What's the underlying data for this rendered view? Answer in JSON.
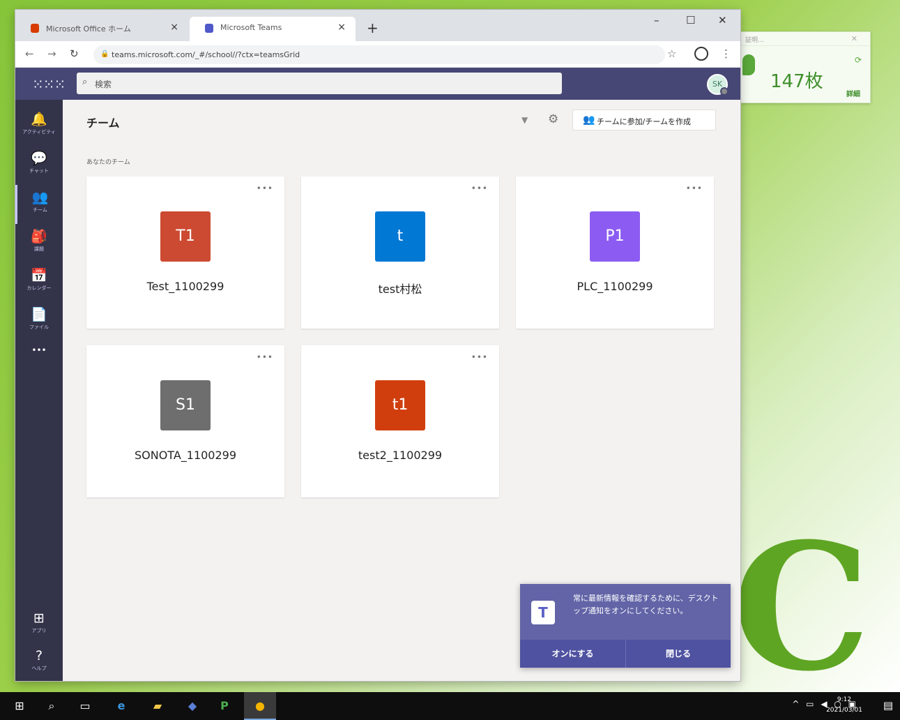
{
  "desktop": {
    "widget": {
      "title": "証明…",
      "count": "147枚",
      "link": "詳細"
    },
    "big_letter": "C"
  },
  "browser": {
    "tabs": [
      {
        "label": "Microsoft Office ホーム",
        "icon": "office-icon",
        "color": "#d83b01"
      },
      {
        "label": "Microsoft Teams",
        "icon": "teams-icon",
        "color": "#5059c9"
      }
    ],
    "url": "teams.microsoft.com/_#/school//?ctx=teamsGrid"
  },
  "teams": {
    "search_placeholder": "検索",
    "avatar_initials": "SK",
    "rail": [
      {
        "label": "アクティビティ",
        "icon": "bell-icon",
        "glyph": "🔔"
      },
      {
        "label": "チャット",
        "icon": "chat-icon",
        "glyph": "💬"
      },
      {
        "label": "チーム",
        "icon": "teams-icon",
        "glyph": "👥"
      },
      {
        "label": "課題",
        "icon": "assignments-icon",
        "glyph": "🎒"
      },
      {
        "label": "カレンダー",
        "icon": "calendar-icon",
        "glyph": "📅"
      },
      {
        "label": "ファイル",
        "icon": "file-icon",
        "glyph": "📄"
      },
      {
        "label": "",
        "icon": "more-icon",
        "glyph": "•••"
      }
    ],
    "rail_bottom": [
      {
        "label": "アプリ",
        "icon": "apps-icon",
        "glyph": "⊞"
      },
      {
        "label": "ヘルプ",
        "icon": "help-icon",
        "glyph": "?"
      }
    ],
    "page_title": "チーム",
    "join_button": "チームに参加/チームを作成",
    "section_label": "あなたのチーム",
    "cards": [
      {
        "initials": "T1",
        "name": "Test_1100299",
        "color": "#cc4a31"
      },
      {
        "initials": "t",
        "name": "test村松",
        "color": "#0078d4"
      },
      {
        "initials": "P1",
        "name": "PLC_1100299",
        "color": "#8c5cf2"
      },
      {
        "initials": "S1",
        "name": "SONOTA_1100299",
        "color": "#6e6e6e"
      },
      {
        "initials": "t1",
        "name": "test2_1100299",
        "color": "#d13e0e"
      }
    ],
    "toast": {
      "message": "常に最新情報を確認するために、デスクトップ通知をオンにしてください。",
      "enable": "オンにする",
      "close": "閉じる"
    }
  },
  "taskbar": {
    "time": "9:12",
    "date": "2021/03/01"
  }
}
